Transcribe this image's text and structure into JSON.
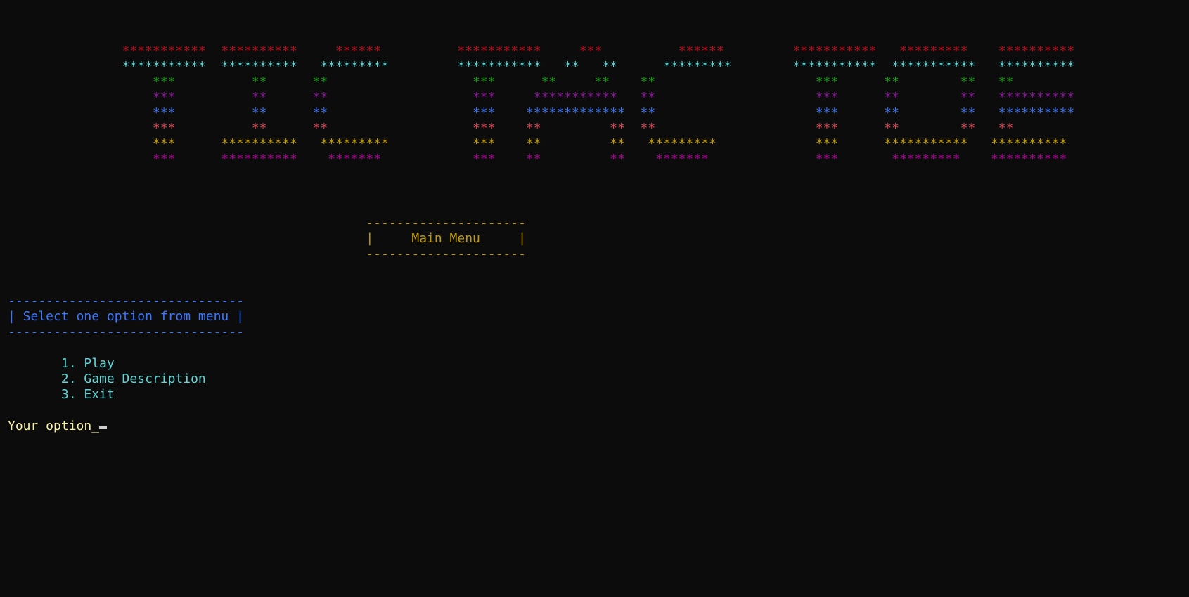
{
  "banner": {
    "rows": [
      {
        "text": "               ***********  **********     ******          ***********     ***          ******         ***********   *********    **********",
        "color": "#c50f1f"
      },
      {
        "text": "               ***********  **********   *********         ***********   **   **      *********        ***********  ***********   **********",
        "color": "#61d6d6"
      },
      {
        "text": "                   ***          **      **                   ***      **     **    **                     ***      **        **   **",
        "color": "#13a10e"
      },
      {
        "text": "                   ***          **      **                   ***     ***********   **                     ***      **        **   **********",
        "color": "#881798"
      },
      {
        "text": "                   ***          **      **                   ***    *************  **                     ***      **        **   **********",
        "color": "#3b78ff"
      },
      {
        "text": "                   ***          **      **                   ***    **         **  **                     ***      **        **   **",
        "color": "#e74856"
      },
      {
        "text": "                   ***      **********   *********           ***    **         **   *********             ***      ***********   **********",
        "color": "#c19c00"
      },
      {
        "text": "                   ***      **********    *******            ***    **         **    *******              ***       *********    **********",
        "color": "#b4009e"
      }
    ]
  },
  "main_menu": {
    "border_top": "                                               ---------------------",
    "label_line": "                                               |     Main Menu     |",
    "border_bottom": "                                               ---------------------",
    "color": "#c19c00"
  },
  "select_box": {
    "border_top": "-------------------------------",
    "label_line": "| Select one option from menu |",
    "border_bottom": "-------------------------------",
    "color": "#3b78ff"
  },
  "options": [
    {
      "label": "       1. Play"
    },
    {
      "label": "       2. Game Description"
    },
    {
      "label": "       3. Exit"
    }
  ],
  "options_color": "#61d6d6",
  "prompt": {
    "label": "Your option_",
    "color": "#f9f1a5"
  }
}
